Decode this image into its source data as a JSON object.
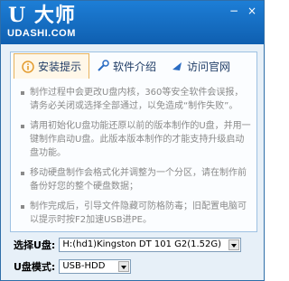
{
  "header": {
    "brand_mark": "U 大师",
    "brand_url": "UDASHI.COM"
  },
  "window_controls": [
    {
      "name": "minimize-button",
      "glyph": "−"
    },
    {
      "name": "close-button",
      "glyph": "×"
    }
  ],
  "tabs": [
    {
      "label": "安装提示",
      "icon": "info-icon",
      "active": true
    },
    {
      "label": "软件介绍",
      "icon": "tools-icon",
      "active": false
    },
    {
      "label": "访问官网",
      "icon": "arrow-icon",
      "active": false
    }
  ],
  "tips": [
    "制作过程中会更改U盘内核，360等安全软件会误报，请务必关闭或选择全部通过，以免造成“制作失败”。",
    "请用初始化U盘功能还原以前的版本制作的U盘，并用一键制作启动U盘。此版本版本制作的才能支持升级启动盘功能。",
    "移动硬盘制作会格式化并调整为一个分区，请在制作前备份好您的整个硬盘数据；",
    "制作完成后，引导文件隐藏可防格防毒；旧配置电脑可以提示时按F2加速USB进PE。"
  ],
  "form": {
    "select_disk_label": "选择U盘:",
    "select_disk_value": "H:(hd1)Kingston DT 101 G2(1.52G)",
    "mode_label": "U盘模式:",
    "mode_value": "USB-HDD"
  },
  "colors": {
    "titlebar": "#1d7ed6",
    "panel_border": "#9ec1e2",
    "active_tab_border": "#e7b25b"
  }
}
